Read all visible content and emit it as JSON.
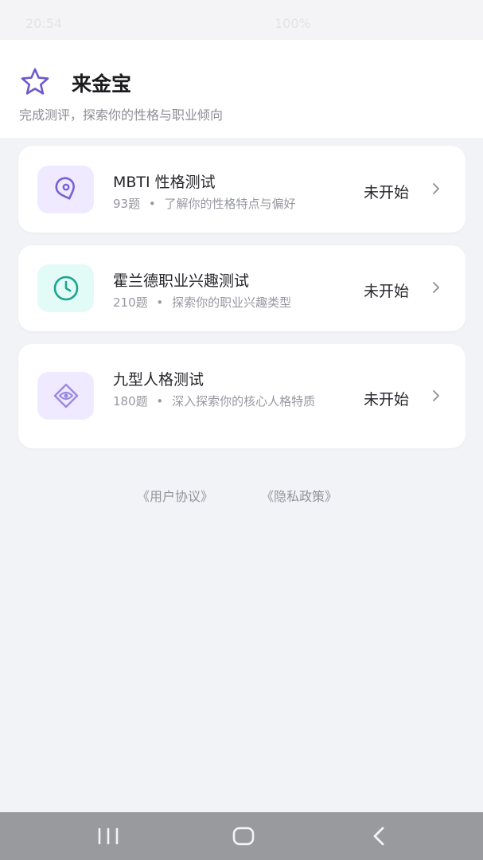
{
  "status_bar": {
    "time": "20:54",
    "right": "100%"
  },
  "header": {
    "title": "来金宝",
    "subtitle": "完成测评，探索你的性格与职业倾向",
    "icon": "star-icon",
    "accent_color": "#6a5acd"
  },
  "tests": [
    {
      "name": "MBTI 性格测试",
      "count": "93题",
      "separator": "•",
      "desc": "了解你的性格特点与偏好",
      "status": "未开始",
      "icon": "map-pin-icon"
    },
    {
      "name": "霍兰德职业兴趣测试",
      "count": "210题",
      "separator": "•",
      "desc": "探索你的职业兴趣类型",
      "status": "未开始",
      "icon": "clock-icon"
    },
    {
      "name": "九型人格测试",
      "count": "180题",
      "separator": "•",
      "desc": "深入探索你的核心人格特质",
      "status": "未开始",
      "icon": "eye-icon"
    }
  ],
  "links": {
    "user_agreement": "《用户协议》",
    "privacy_policy": "《隐私政策》"
  },
  "navbar": {
    "recent": "recent-apps-icon",
    "home": "home-icon",
    "back": "back-icon"
  }
}
